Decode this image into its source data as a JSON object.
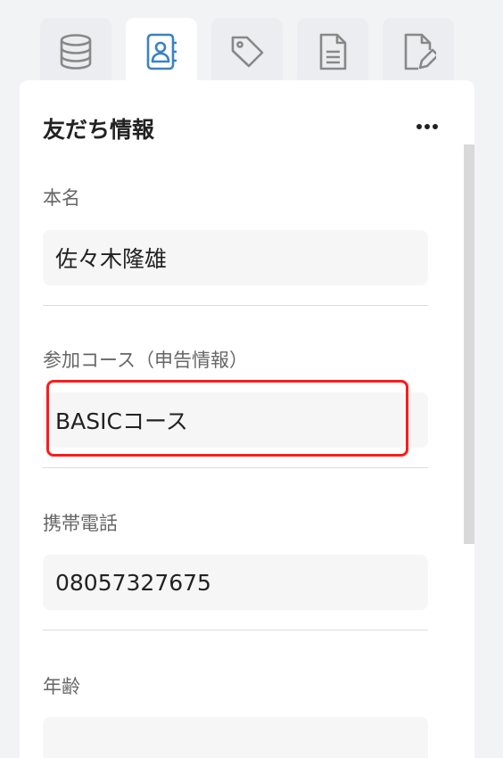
{
  "tabs": [
    {
      "icon": "database-icon",
      "active": false
    },
    {
      "icon": "contact-book-icon",
      "active": true
    },
    {
      "icon": "tag-icon",
      "active": false
    },
    {
      "icon": "document-icon",
      "active": false
    },
    {
      "icon": "edit-document-icon",
      "active": false
    }
  ],
  "colors": {
    "accent": "#3b82c4",
    "icon": "#888888",
    "highlight": "#ff1a1a"
  },
  "panel": {
    "title": "友だち情報",
    "more_icon": "ellipsis-icon"
  },
  "fields": [
    {
      "label": "本名",
      "value": "佐々木隆雄"
    },
    {
      "label": "参加コース（申告情報）",
      "value": "BASICコース"
    },
    {
      "label": "携帯電話",
      "value": "08057327675"
    },
    {
      "label": "年齢",
      "value": ""
    }
  ]
}
